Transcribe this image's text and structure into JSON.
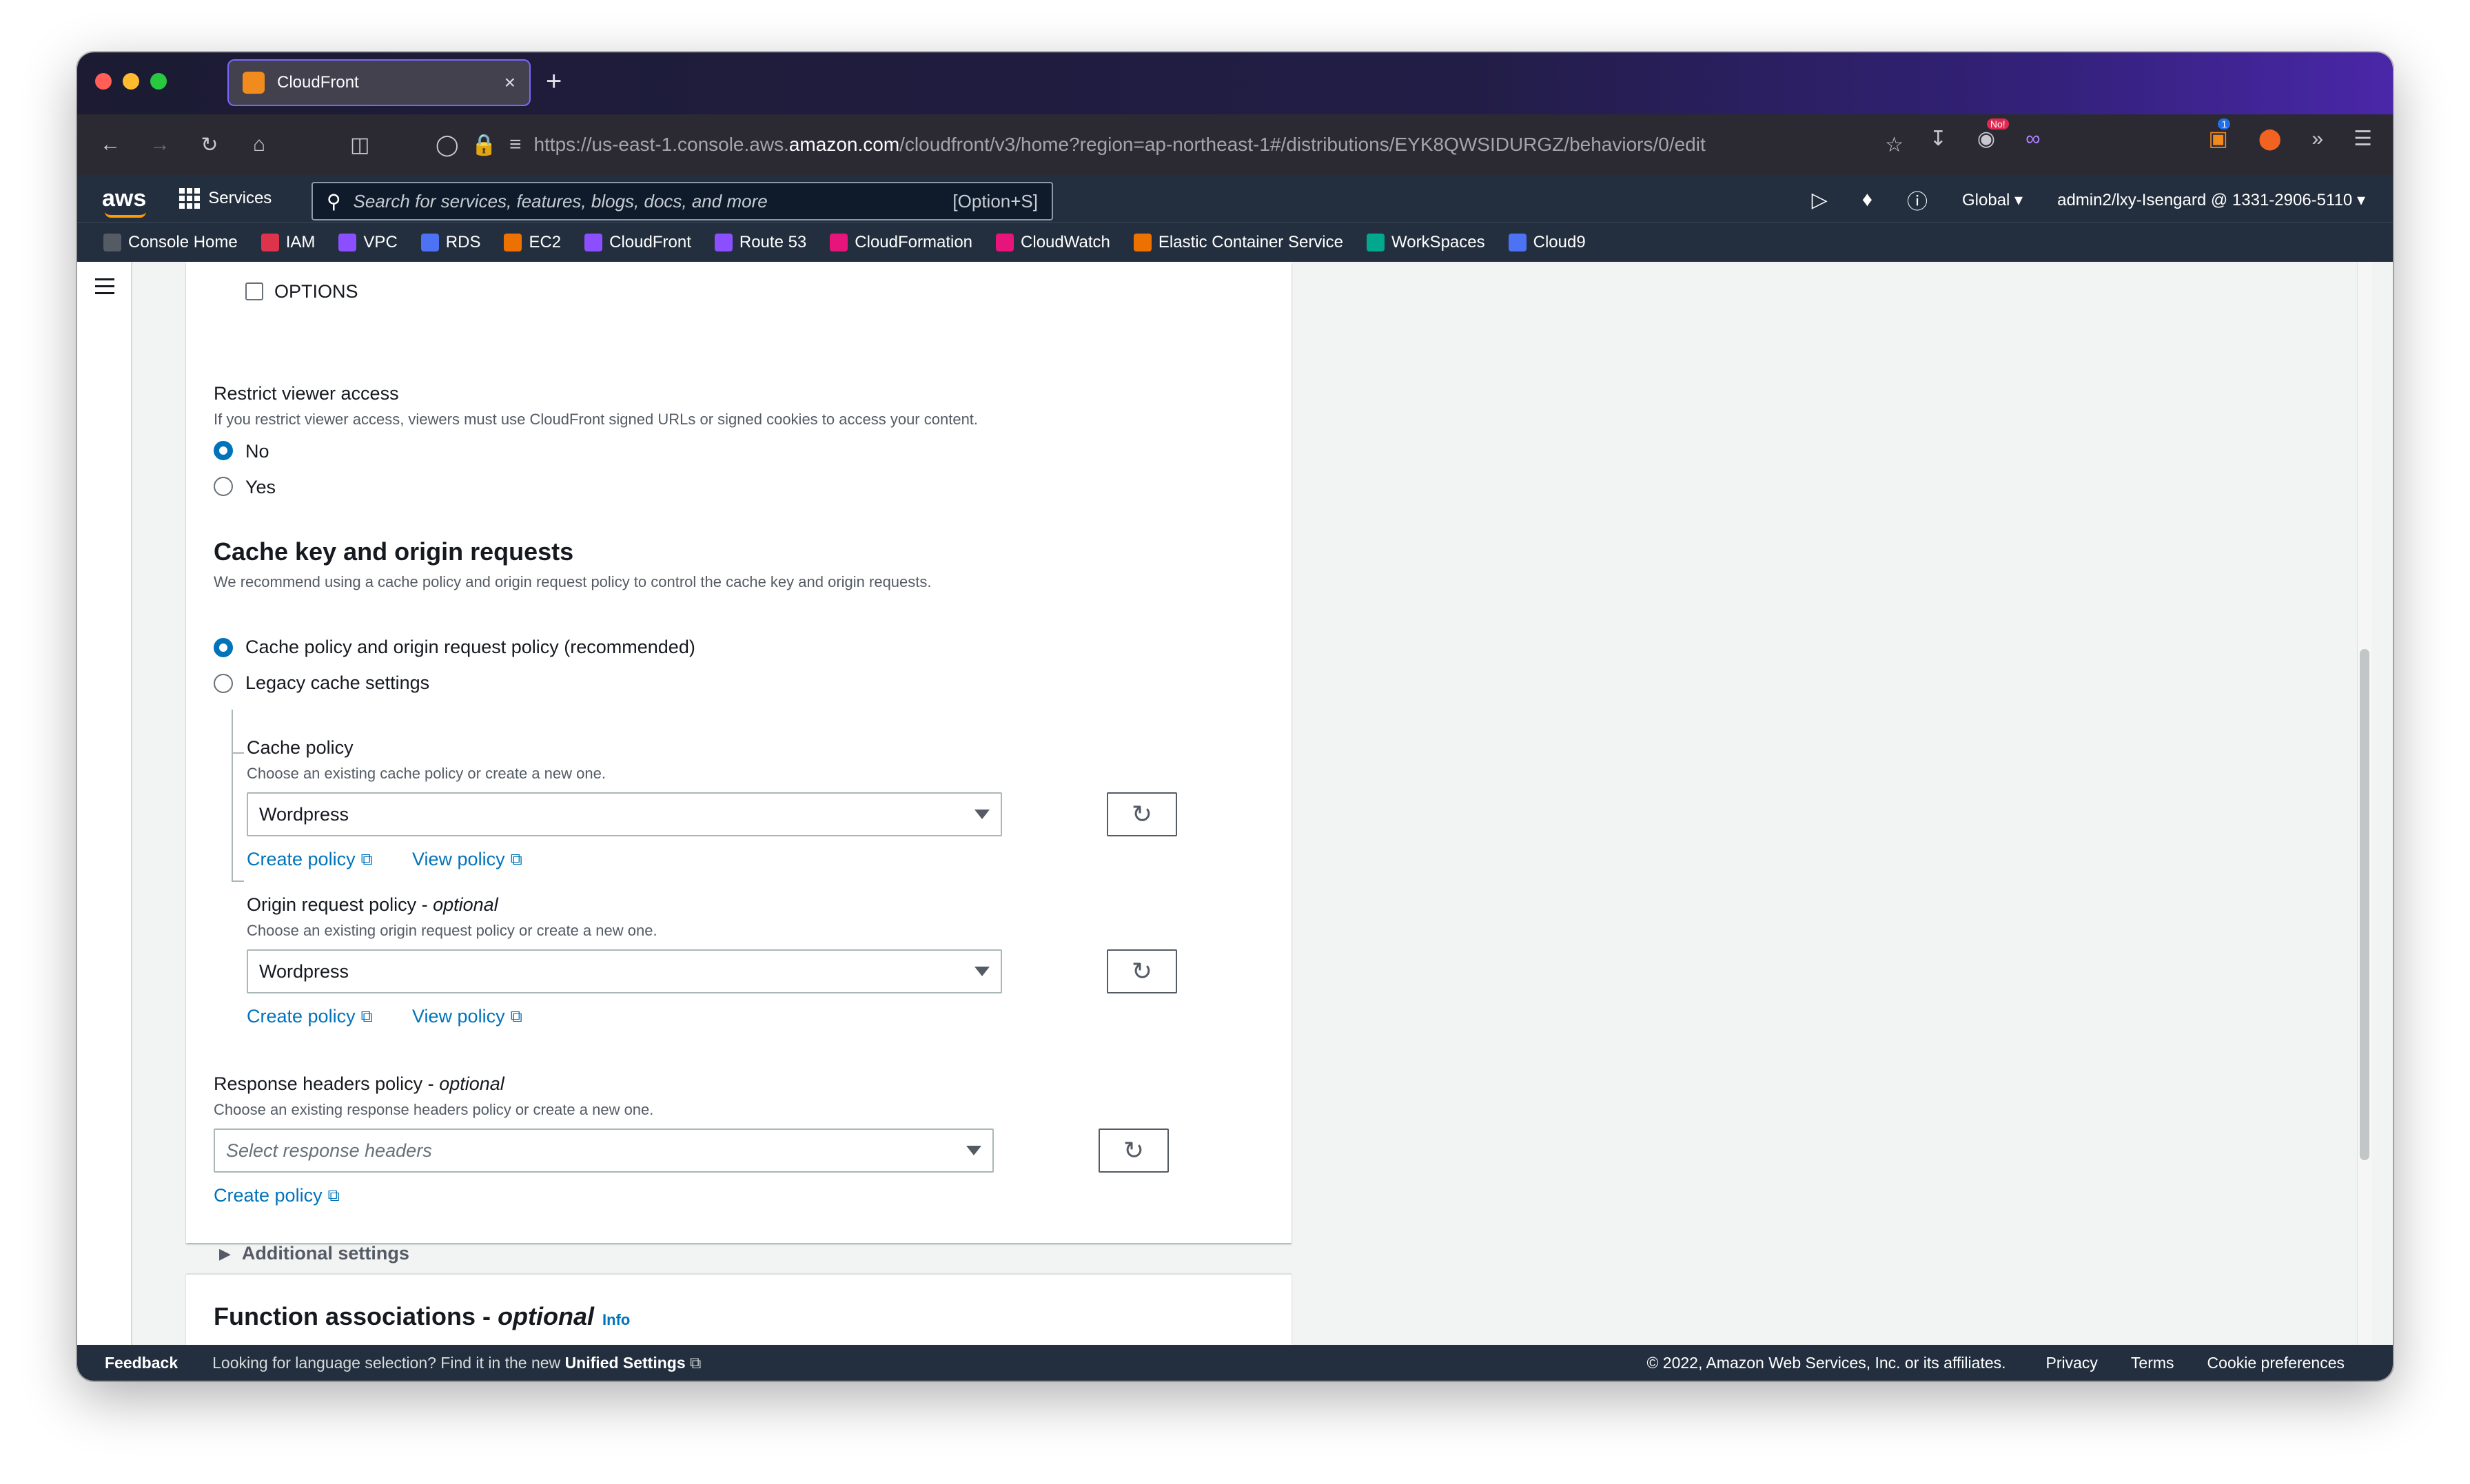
{
  "browser": {
    "tab_title": "CloudFront",
    "tab_close": "×",
    "new_tab": "+",
    "url_prefix": "https://us-east-1.console.aws.",
    "url_domain": "amazon.com",
    "url_path": "/cloudfront/v3/home?region=ap-northeast-1#/distributions/EYK8QWSIDURGZ/behaviors/0/edit",
    "badge_no": "No!",
    "badge_count": "1"
  },
  "aws_header": {
    "logo": "aws",
    "services_label": "Services",
    "search_placeholder": "Search for services, features, blogs, docs, and more",
    "search_shortcut": "[Option+S]",
    "region": "Global",
    "account": "admin2/lxy-Isengard @ 1331-2906-5110"
  },
  "favorites": [
    {
      "label": "Console Home",
      "color": "#545b64"
    },
    {
      "label": "IAM",
      "color": "#dd344c"
    },
    {
      "label": "VPC",
      "color": "#8c4fff"
    },
    {
      "label": "RDS",
      "color": "#4d72f3"
    },
    {
      "label": "EC2",
      "color": "#ed7100"
    },
    {
      "label": "CloudFront",
      "color": "#8c4fff"
    },
    {
      "label": "Route 53",
      "color": "#8c4fff"
    },
    {
      "label": "CloudFormation",
      "color": "#e7157b"
    },
    {
      "label": "CloudWatch",
      "color": "#e7157b"
    },
    {
      "label": "Elastic Container Service",
      "color": "#ed7100"
    },
    {
      "label": "WorkSpaces",
      "color": "#01a88d"
    },
    {
      "label": "Cloud9",
      "color": "#4d72f3"
    }
  ],
  "form": {
    "options_checkbox_label": "OPTIONS",
    "restrict": {
      "label": "Restrict viewer access",
      "description": "If you restrict viewer access, viewers must use CloudFront signed URLs or signed cookies to access your content.",
      "option_no": "No",
      "option_yes": "Yes"
    },
    "cache_key": {
      "heading": "Cache key and origin requests",
      "description": "We recommend using a cache policy and origin request policy to control the cache key and origin requests.",
      "option_recommended": "Cache policy and origin request policy (recommended)",
      "option_legacy": "Legacy cache settings"
    },
    "cache_policy": {
      "label": "Cache policy",
      "description": "Choose an existing cache policy or create a new one.",
      "value": "Wordpress",
      "create_link": "Create policy",
      "view_link": "View policy"
    },
    "origin_policy": {
      "label": "Origin request policy - ",
      "label_optional": "optional",
      "description": "Choose an existing origin request policy or create a new one.",
      "value": "Wordpress",
      "create_link": "Create policy",
      "view_link": "View policy"
    },
    "response_policy": {
      "label": "Response headers policy - ",
      "label_optional": "optional",
      "description": "Choose an existing response headers policy or create a new one.",
      "placeholder": "Select response headers",
      "create_link": "Create policy"
    },
    "additional_settings": "Additional settings",
    "function_associations": {
      "heading": "Function associations - ",
      "heading_optional": "optional",
      "info": "Info"
    }
  },
  "footer": {
    "feedback": "Feedback",
    "language_text": "Looking for language selection? Find it in the new ",
    "unified_settings": "Unified Settings",
    "copyright": "© 2022, Amazon Web Services, Inc. or its affiliates.",
    "privacy": "Privacy",
    "terms": "Terms",
    "cookie": "Cookie preferences"
  }
}
